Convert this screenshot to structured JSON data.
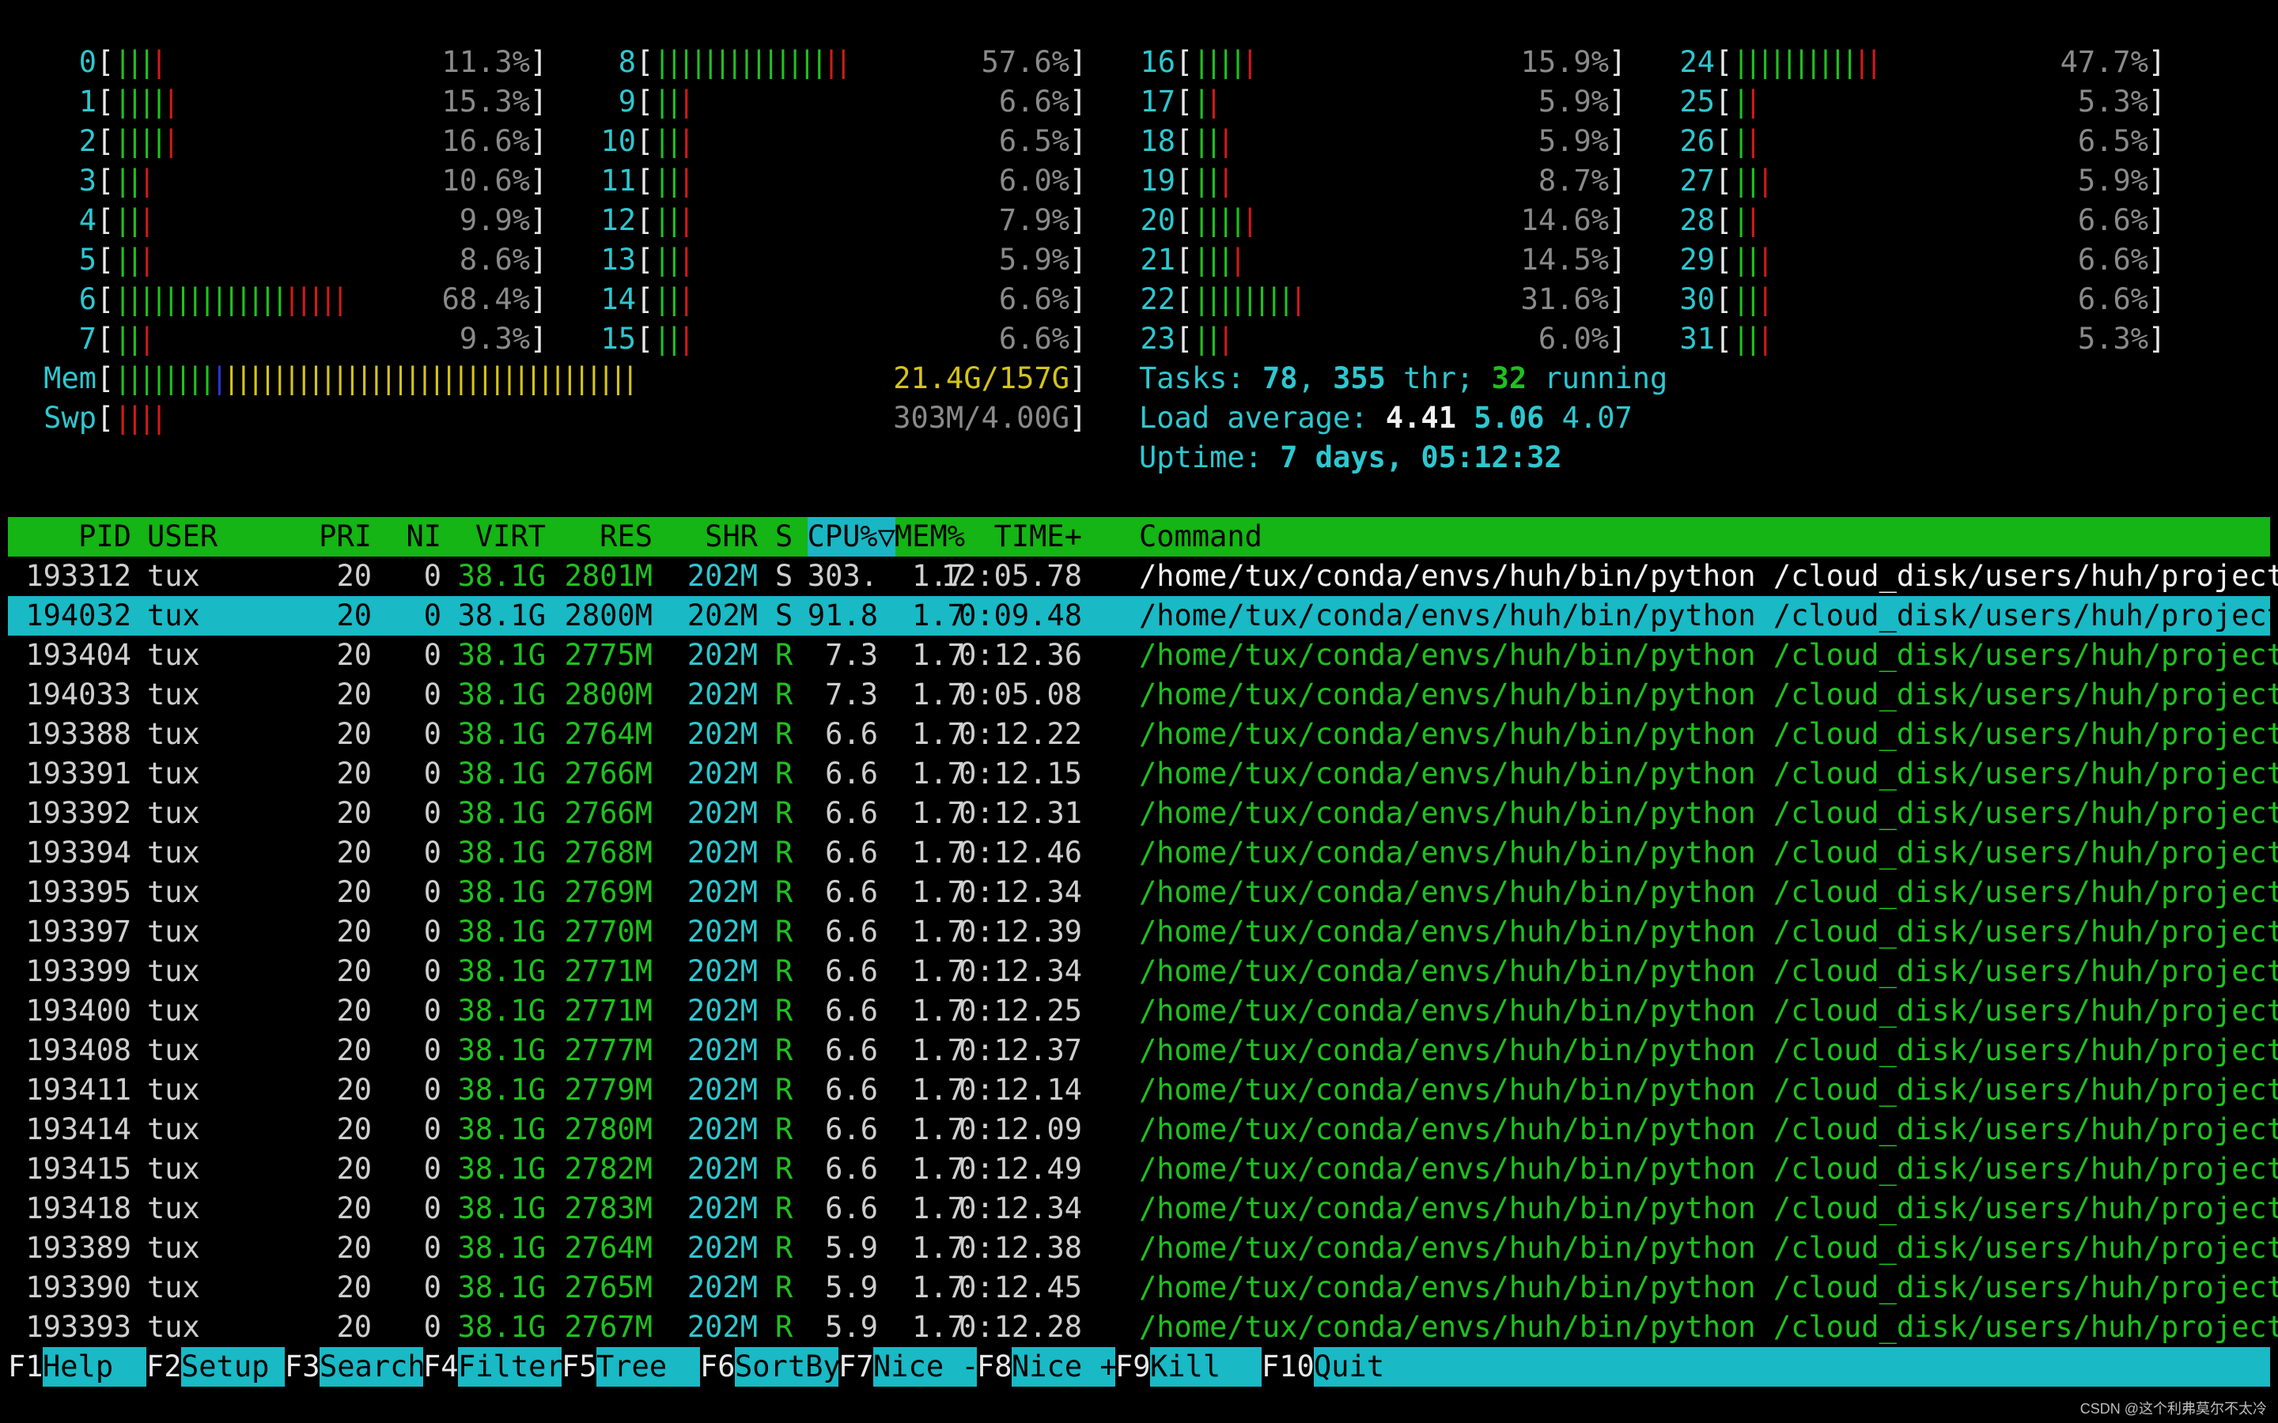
{
  "cpus": [
    {
      "id": "0",
      "pct": "11.3%",
      "g": 3,
      "r": 1
    },
    {
      "id": "1",
      "pct": "15.3%",
      "g": 4,
      "r": 1
    },
    {
      "id": "2",
      "pct": "16.6%",
      "g": 4,
      "r": 1
    },
    {
      "id": "3",
      "pct": "10.6%",
      "g": 2,
      "r": 1
    },
    {
      "id": "4",
      "pct": "9.9%",
      "g": 2,
      "r": 1
    },
    {
      "id": "5",
      "pct": "8.6%",
      "g": 2,
      "r": 1
    },
    {
      "id": "6",
      "pct": "68.4%",
      "g": 14,
      "r": 5
    },
    {
      "id": "7",
      "pct": "9.3%",
      "g": 2,
      "r": 1
    },
    {
      "id": "8",
      "pct": "57.6%",
      "g": 14,
      "r": 2
    },
    {
      "id": "9",
      "pct": "6.6%",
      "g": 2,
      "r": 1
    },
    {
      "id": "10",
      "pct": "6.5%",
      "g": 2,
      "r": 1
    },
    {
      "id": "11",
      "pct": "6.0%",
      "g": 2,
      "r": 1
    },
    {
      "id": "12",
      "pct": "7.9%",
      "g": 2,
      "r": 1
    },
    {
      "id": "13",
      "pct": "5.9%",
      "g": 2,
      "r": 1
    },
    {
      "id": "14",
      "pct": "6.6%",
      "g": 2,
      "r": 1
    },
    {
      "id": "15",
      "pct": "6.6%",
      "g": 2,
      "r": 1
    },
    {
      "id": "16",
      "pct": "15.9%",
      "g": 4,
      "r": 1
    },
    {
      "id": "17",
      "pct": "5.9%",
      "g": 1,
      "r": 1
    },
    {
      "id": "18",
      "pct": "5.9%",
      "g": 2,
      "r": 1
    },
    {
      "id": "19",
      "pct": "8.7%",
      "g": 2,
      "r": 1
    },
    {
      "id": "20",
      "pct": "14.6%",
      "g": 4,
      "r": 1
    },
    {
      "id": "21",
      "pct": "14.5%",
      "g": 3,
      "r": 1
    },
    {
      "id": "22",
      "pct": "31.6%",
      "g": 8,
      "r": 1
    },
    {
      "id": "23",
      "pct": "6.0%",
      "g": 2,
      "r": 1
    },
    {
      "id": "24",
      "pct": "47.7%",
      "g": 10,
      "r": 2
    },
    {
      "id": "25",
      "pct": "5.3%",
      "g": 1,
      "r": 1
    },
    {
      "id": "26",
      "pct": "6.5%",
      "g": 1,
      "r": 1
    },
    {
      "id": "27",
      "pct": "5.9%",
      "g": 2,
      "r": 1
    },
    {
      "id": "28",
      "pct": "6.6%",
      "g": 1,
      "r": 1
    },
    {
      "id": "29",
      "pct": "6.6%",
      "g": 2,
      "r": 1
    },
    {
      "id": "30",
      "pct": "6.6%",
      "g": 2,
      "r": 1
    },
    {
      "id": "31",
      "pct": "5.3%",
      "g": 2,
      "r": 1
    }
  ],
  "mem": {
    "label": "Mem",
    "value": "21.4G/157G",
    "g": 8,
    "b": 1,
    "y": 34
  },
  "swp": {
    "label": "Swp",
    "value": "303M/4.00G",
    "r": 4
  },
  "summary": {
    "tasks_label": "Tasks:",
    "tasks": "78",
    "thr_count": "355",
    "thr_label": "thr;",
    "running_count": "32",
    "running_label": "running",
    "load_label": "Load average:",
    "load1": "4.41",
    "load5": "5.06",
    "load15": "4.07",
    "uptime_label": "Uptime:",
    "uptime": "7 days, 05:12:32"
  },
  "table": {
    "headers": {
      "pid": "PID",
      "user": "USER",
      "pri": "PRI",
      "ni": "NI",
      "virt": "VIRT",
      "res": "RES",
      "shr": "SHR",
      "s": "S",
      "cpu": "CPU%▽",
      "mem": "MEM%",
      "time": "TIME+",
      "command": "Command"
    },
    "rows": [
      {
        "pid": "193312",
        "user": "tux",
        "pri": "20",
        "ni": "0",
        "virt": "38.1G",
        "res": "2801M",
        "shr": "202M",
        "s": "S",
        "cpu": "303.",
        "mem": "1.7",
        "time": "12:05.78",
        "cmd": "/home/tux/conda/envs/huh/bin/python /cloud_disk/users/huh/project"
      },
      {
        "pid": "194032",
        "user": "tux",
        "pri": "20",
        "ni": "0",
        "virt": "38.1G",
        "res": "2800M",
        "shr": "202M",
        "s": "S",
        "cpu": "91.8",
        "mem": "1.7",
        "time": "0:09.48",
        "cmd": "/home/tux/conda/envs/huh/bin/python /cloud_disk/users/huh/project"
      },
      {
        "pid": "193404",
        "user": "tux",
        "pri": "20",
        "ni": "0",
        "virt": "38.1G",
        "res": "2775M",
        "shr": "202M",
        "s": "R",
        "cpu": "7.3",
        "mem": "1.7",
        "time": "0:12.36",
        "cmd": "/home/tux/conda/envs/huh/bin/python /cloud_disk/users/huh/project"
      },
      {
        "pid": "194033",
        "user": "tux",
        "pri": "20",
        "ni": "0",
        "virt": "38.1G",
        "res": "2800M",
        "shr": "202M",
        "s": "R",
        "cpu": "7.3",
        "mem": "1.7",
        "time": "0:05.08",
        "cmd": "/home/tux/conda/envs/huh/bin/python /cloud_disk/users/huh/project"
      },
      {
        "pid": "193388",
        "user": "tux",
        "pri": "20",
        "ni": "0",
        "virt": "38.1G",
        "res": "2764M",
        "shr": "202M",
        "s": "R",
        "cpu": "6.6",
        "mem": "1.7",
        "time": "0:12.22",
        "cmd": "/home/tux/conda/envs/huh/bin/python /cloud_disk/users/huh/project"
      },
      {
        "pid": "193391",
        "user": "tux",
        "pri": "20",
        "ni": "0",
        "virt": "38.1G",
        "res": "2766M",
        "shr": "202M",
        "s": "R",
        "cpu": "6.6",
        "mem": "1.7",
        "time": "0:12.15",
        "cmd": "/home/tux/conda/envs/huh/bin/python /cloud_disk/users/huh/project"
      },
      {
        "pid": "193392",
        "user": "tux",
        "pri": "20",
        "ni": "0",
        "virt": "38.1G",
        "res": "2766M",
        "shr": "202M",
        "s": "R",
        "cpu": "6.6",
        "mem": "1.7",
        "time": "0:12.31",
        "cmd": "/home/tux/conda/envs/huh/bin/python /cloud_disk/users/huh/project"
      },
      {
        "pid": "193394",
        "user": "tux",
        "pri": "20",
        "ni": "0",
        "virt": "38.1G",
        "res": "2768M",
        "shr": "202M",
        "s": "R",
        "cpu": "6.6",
        "mem": "1.7",
        "time": "0:12.46",
        "cmd": "/home/tux/conda/envs/huh/bin/python /cloud_disk/users/huh/project"
      },
      {
        "pid": "193395",
        "user": "tux",
        "pri": "20",
        "ni": "0",
        "virt": "38.1G",
        "res": "2769M",
        "shr": "202M",
        "s": "R",
        "cpu": "6.6",
        "mem": "1.7",
        "time": "0:12.34",
        "cmd": "/home/tux/conda/envs/huh/bin/python /cloud_disk/users/huh/project"
      },
      {
        "pid": "193397",
        "user": "tux",
        "pri": "20",
        "ni": "0",
        "virt": "38.1G",
        "res": "2770M",
        "shr": "202M",
        "s": "R",
        "cpu": "6.6",
        "mem": "1.7",
        "time": "0:12.39",
        "cmd": "/home/tux/conda/envs/huh/bin/python /cloud_disk/users/huh/project"
      },
      {
        "pid": "193399",
        "user": "tux",
        "pri": "20",
        "ni": "0",
        "virt": "38.1G",
        "res": "2771M",
        "shr": "202M",
        "s": "R",
        "cpu": "6.6",
        "mem": "1.7",
        "time": "0:12.34",
        "cmd": "/home/tux/conda/envs/huh/bin/python /cloud_disk/users/huh/project"
      },
      {
        "pid": "193400",
        "user": "tux",
        "pri": "20",
        "ni": "0",
        "virt": "38.1G",
        "res": "2771M",
        "shr": "202M",
        "s": "R",
        "cpu": "6.6",
        "mem": "1.7",
        "time": "0:12.25",
        "cmd": "/home/tux/conda/envs/huh/bin/python /cloud_disk/users/huh/project"
      },
      {
        "pid": "193408",
        "user": "tux",
        "pri": "20",
        "ni": "0",
        "virt": "38.1G",
        "res": "2777M",
        "shr": "202M",
        "s": "R",
        "cpu": "6.6",
        "mem": "1.7",
        "time": "0:12.37",
        "cmd": "/home/tux/conda/envs/huh/bin/python /cloud_disk/users/huh/project"
      },
      {
        "pid": "193411",
        "user": "tux",
        "pri": "20",
        "ni": "0",
        "virt": "38.1G",
        "res": "2779M",
        "shr": "202M",
        "s": "R",
        "cpu": "6.6",
        "mem": "1.7",
        "time": "0:12.14",
        "cmd": "/home/tux/conda/envs/huh/bin/python /cloud_disk/users/huh/project"
      },
      {
        "pid": "193414",
        "user": "tux",
        "pri": "20",
        "ni": "0",
        "virt": "38.1G",
        "res": "2780M",
        "shr": "202M",
        "s": "R",
        "cpu": "6.6",
        "mem": "1.7",
        "time": "0:12.09",
        "cmd": "/home/tux/conda/envs/huh/bin/python /cloud_disk/users/huh/project"
      },
      {
        "pid": "193415",
        "user": "tux",
        "pri": "20",
        "ni": "0",
        "virt": "38.1G",
        "res": "2782M",
        "shr": "202M",
        "s": "R",
        "cpu": "6.6",
        "mem": "1.7",
        "time": "0:12.49",
        "cmd": "/home/tux/conda/envs/huh/bin/python /cloud_disk/users/huh/project"
      },
      {
        "pid": "193418",
        "user": "tux",
        "pri": "20",
        "ni": "0",
        "virt": "38.1G",
        "res": "2783M",
        "shr": "202M",
        "s": "R",
        "cpu": "6.6",
        "mem": "1.7",
        "time": "0:12.34",
        "cmd": "/home/tux/conda/envs/huh/bin/python /cloud_disk/users/huh/project"
      },
      {
        "pid": "193389",
        "user": "tux",
        "pri": "20",
        "ni": "0",
        "virt": "38.1G",
        "res": "2764M",
        "shr": "202M",
        "s": "R",
        "cpu": "5.9",
        "mem": "1.7",
        "time": "0:12.38",
        "cmd": "/home/tux/conda/envs/huh/bin/python /cloud_disk/users/huh/project"
      },
      {
        "pid": "193390",
        "user": "tux",
        "pri": "20",
        "ni": "0",
        "virt": "38.1G",
        "res": "2765M",
        "shr": "202M",
        "s": "R",
        "cpu": "5.9",
        "mem": "1.7",
        "time": "0:12.45",
        "cmd": "/home/tux/conda/envs/huh/bin/python /cloud_disk/users/huh/project"
      },
      {
        "pid": "193393",
        "user": "tux",
        "pri": "20",
        "ni": "0",
        "virt": "38.1G",
        "res": "2767M",
        "shr": "202M",
        "s": "R",
        "cpu": "5.9",
        "mem": "1.7",
        "time": "0:12.28",
        "cmd": "/home/tux/conda/envs/huh/bin/python /cloud_disk/users/huh/project"
      }
    ]
  },
  "fkeys": [
    {
      "key": "F1",
      "label": "Help"
    },
    {
      "key": "F2",
      "label": "Setup"
    },
    {
      "key": "F3",
      "label": "Search"
    },
    {
      "key": "F4",
      "label": "Filter"
    },
    {
      "key": "F5",
      "label": "Tree"
    },
    {
      "key": "F6",
      "label": "SortBy"
    },
    {
      "key": "F7",
      "label": "Nice -"
    },
    {
      "key": "F8",
      "label": "Nice +"
    },
    {
      "key": "F9",
      "label": "Kill"
    },
    {
      "key": "F10",
      "label": "Quit"
    }
  ],
  "watermark": "CSDN @这个利弗莫尔不太冷",
  "colors": {
    "bg": "#000000",
    "header_bg": "#14b514",
    "selection_bg": "#19b9c5",
    "cyan": "#2ec7cf",
    "green": "#1fc11f",
    "red": "#d01a1a",
    "yellow": "#d4c419"
  }
}
